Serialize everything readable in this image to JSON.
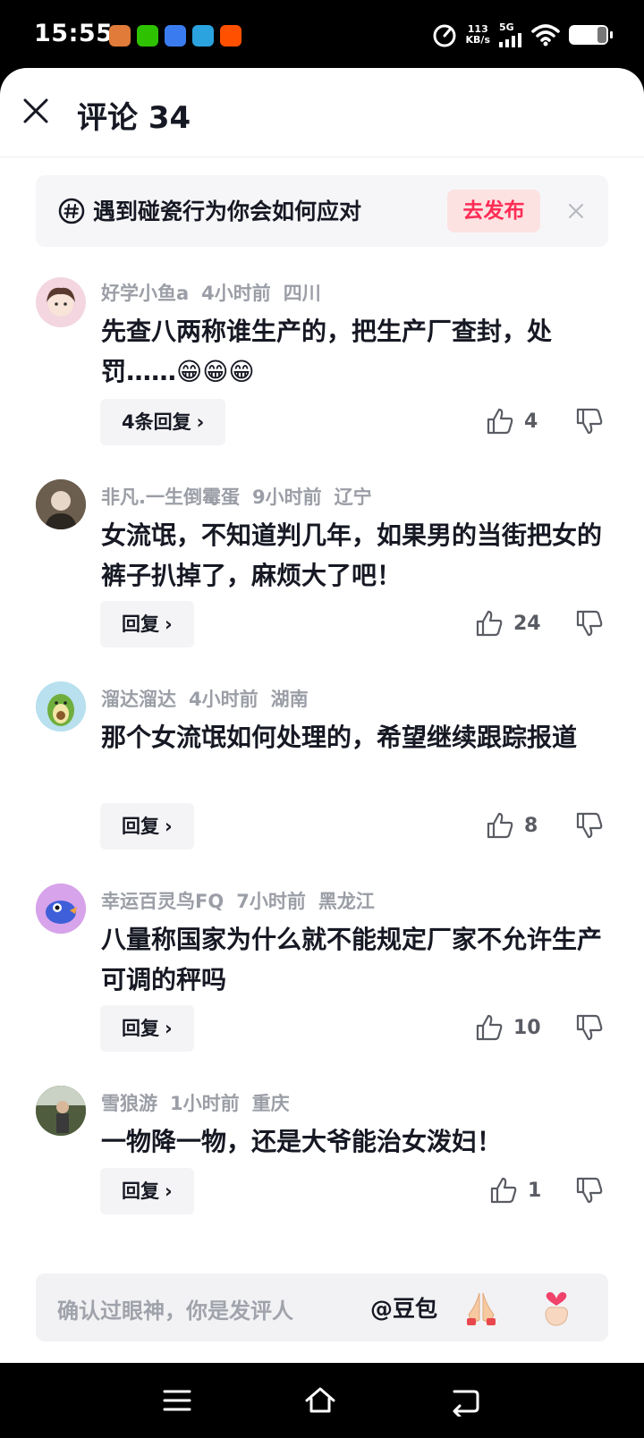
{
  "status_bar": {
    "time": "15:55",
    "net_speed_value": "113",
    "net_speed_unit": "KB/s",
    "signal_label": "5G"
  },
  "header": {
    "title": "评论 34"
  },
  "topic": {
    "text": "遇到碰瓷行为你会如何应对",
    "publish_label": "去发布"
  },
  "comments": [
    {
      "username": "好学小鱼a",
      "time_ago": "4小时前",
      "location": "四川",
      "text": "先查八两称谁生产的，把生产厂查封，处罚……😁😁😁",
      "reply_label": "4条回复",
      "likes": "4"
    },
    {
      "username": "非凡.一生倒霉蛋",
      "time_ago": "9小时前",
      "location": "辽宁",
      "text": "女流氓，不知道判几年，如果男的当街把女的裤子扒掉了，麻烦大了吧！",
      "reply_label": "回复",
      "likes": "24"
    },
    {
      "username": "溜达溜达",
      "time_ago": "4小时前",
      "location": "湖南",
      "text": "那个女流氓如何处理的，希望继续跟踪报道",
      "reply_label": "回复",
      "likes": "8"
    },
    {
      "username": "幸运百灵鸟FQ",
      "time_ago": "7小时前",
      "location": "黑龙江",
      "text": "八量称国家为什么就不能规定厂家不允许生产可调的秤吗",
      "reply_label": "回复",
      "likes": "10"
    },
    {
      "username": "雪狼游",
      "time_ago": "1小时前",
      "location": "重庆",
      "text": "一物降一物，还是大爷能治女泼妇！",
      "reply_label": "回复",
      "likes": "1"
    }
  ],
  "input_bar": {
    "placeholder": "确认过眼神，你是发评人",
    "mention": "@豆包"
  },
  "colors": {
    "accent": "#fe2c55",
    "text_primary": "#161823",
    "text_secondary": "#9b9ea6"
  }
}
